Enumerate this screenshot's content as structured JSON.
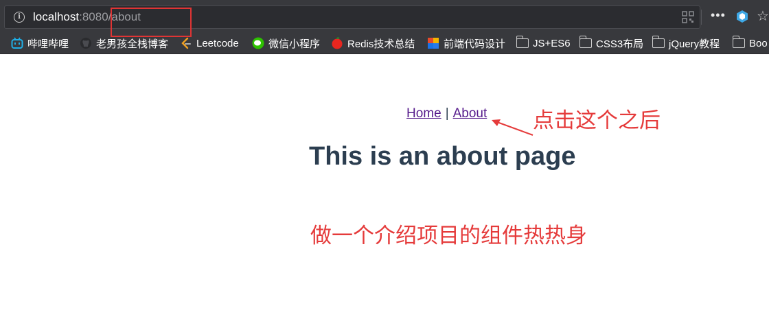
{
  "browser": {
    "url_host": "localhost",
    "url_port": ":8080",
    "url_path": "/about",
    "bookmarks": [
      {
        "label": "哔哩哔哩",
        "icon": "bilibili-icon"
      },
      {
        "label": "老男孩全栈博客",
        "icon": "github-icon"
      },
      {
        "label": "Leetcode",
        "icon": "leetcode-icon"
      },
      {
        "label": "微信小程序",
        "icon": "wechat-icon"
      },
      {
        "label": "Redis技术总结",
        "icon": "redis-icon"
      },
      {
        "label": "前端代码设计",
        "icon": "colorful-blocks-icon"
      },
      {
        "label": "JS+ES6",
        "icon": "folder-icon"
      },
      {
        "label": "CSS3布局",
        "icon": "folder-icon"
      },
      {
        "label": "jQuery教程",
        "icon": "folder-icon"
      },
      {
        "label": "Boo",
        "icon": "folder-icon"
      }
    ],
    "colors": {
      "chrome": "#38393d",
      "highlight": "#e03434"
    }
  },
  "page": {
    "nav": {
      "home": "Home",
      "separator": "|",
      "about": "About"
    },
    "heading": "This is an about page"
  },
  "annotations": {
    "note_click": "点击这个之后",
    "note_intro": "做一个介绍项目的组件热热身",
    "color": "#e53b3b"
  }
}
